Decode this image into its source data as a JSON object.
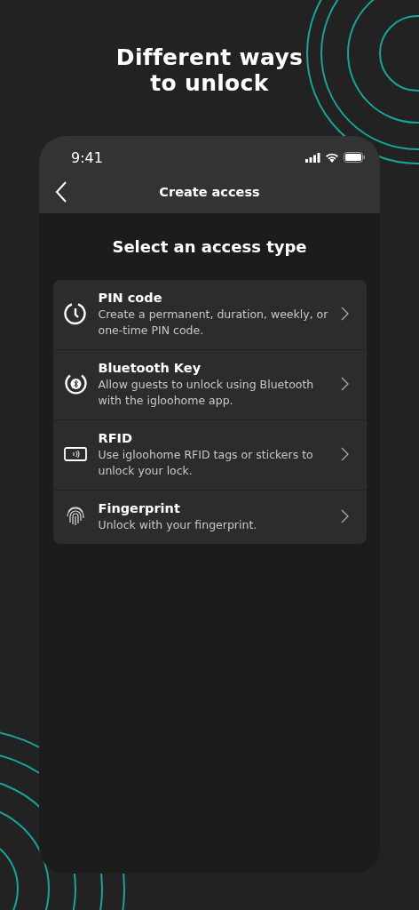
{
  "headline": "Different ways to unlock",
  "status_bar": {
    "time": "9:41"
  },
  "nav": {
    "title": "Create access"
  },
  "section_title": "Select an access type",
  "options": [
    {
      "kind": "pin",
      "title": "PIN code",
      "description": "Create a permanent, duration, weekly, or one-time PIN code."
    },
    {
      "kind": "bluetooth",
      "title": "Bluetooth Key",
      "description": "Allow guests to unlock using Bluetooth with the igloohome app."
    },
    {
      "kind": "rfid",
      "title": "RFID",
      "description": "Use igloohome RFID tags or stickers to unlock your lock."
    },
    {
      "kind": "fingerprint",
      "title": "Fingerprint",
      "description": "Unlock with your fingerprint."
    }
  ]
}
